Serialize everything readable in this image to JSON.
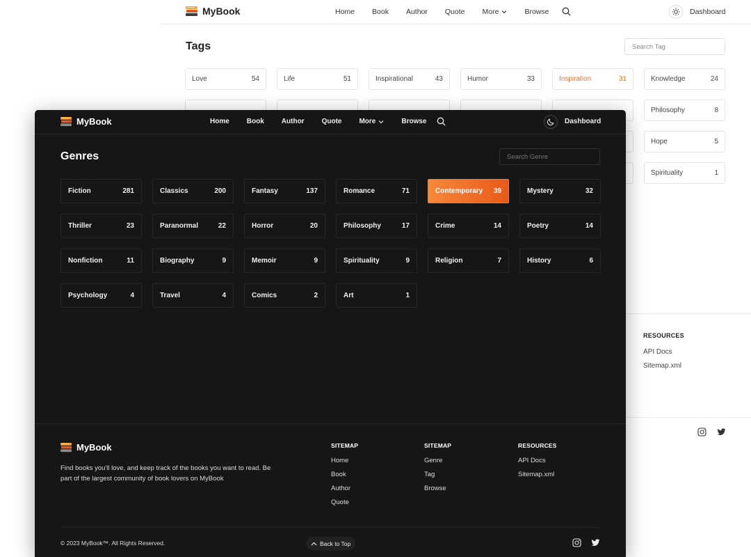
{
  "brand": {
    "name": "MyBook"
  },
  "light": {
    "nav": [
      "Home",
      "Book",
      "Author",
      "Quote",
      "More",
      "Browse"
    ],
    "dashboard": "Dashboard",
    "title": "Tags",
    "search_placeholder": "Search Tag",
    "tags": [
      {
        "label": "Love",
        "count": "54"
      },
      {
        "label": "Life",
        "count": "51"
      },
      {
        "label": "Inspirational",
        "count": "43"
      },
      {
        "label": "Humor",
        "count": "33"
      },
      {
        "label": "Inspiration",
        "count": "31"
      },
      {
        "label": "Knowledge",
        "count": "24"
      },
      {
        "label": "Philosophy",
        "count": "8"
      },
      {
        "label": "Hope",
        "count": "5"
      },
      {
        "label": "Spirituality",
        "count": "1"
      }
    ],
    "footer": {
      "resources_head": "RESOURCES",
      "resources": [
        "API Docs",
        "Sitemap.xml"
      ]
    }
  },
  "dark": {
    "nav": [
      "Home",
      "Book",
      "Author",
      "Quote",
      "More",
      "Browse"
    ],
    "dashboard": "Dashboard",
    "title": "Genres",
    "search_placeholder": "Search Genre",
    "genres": [
      {
        "label": "Fiction",
        "count": "281"
      },
      {
        "label": "Classics",
        "count": "200"
      },
      {
        "label": "Fantasy",
        "count": "137"
      },
      {
        "label": "Romance",
        "count": "71"
      },
      {
        "label": "Contemporary",
        "count": "39"
      },
      {
        "label": "Mystery",
        "count": "32"
      },
      {
        "label": "Thriller",
        "count": "23"
      },
      {
        "label": "Paranormal",
        "count": "22"
      },
      {
        "label": "Horror",
        "count": "20"
      },
      {
        "label": "Philosophy",
        "count": "17"
      },
      {
        "label": "Crime",
        "count": "14"
      },
      {
        "label": "Poetry",
        "count": "14"
      },
      {
        "label": "Nonfiction",
        "count": "11"
      },
      {
        "label": "Biography",
        "count": "9"
      },
      {
        "label": "Memoir",
        "count": "9"
      },
      {
        "label": "Spirituality",
        "count": "9"
      },
      {
        "label": "Religion",
        "count": "7"
      },
      {
        "label": "History",
        "count": "6"
      },
      {
        "label": "Psychology",
        "count": "4"
      },
      {
        "label": "Travel",
        "count": "4"
      },
      {
        "label": "Comics",
        "count": "2"
      },
      {
        "label": "Art",
        "count": "1"
      }
    ],
    "footer": {
      "description": "Find books you'll love, and keep track of the books you want to read. Be part of the largest community of book lovers on MyBook",
      "col1_head": "SITEMAP",
      "col1": [
        "Home",
        "Book",
        "Author",
        "Quote"
      ],
      "col2_head": "SITEMAP",
      "col2": [
        "Genre",
        "Tag",
        "Browse"
      ],
      "col3_head": "RESOURCES",
      "col3": [
        "API Docs",
        "Sitemap.xml"
      ],
      "copyright": "© 2023 MyBook™. All Rights Reserved.",
      "back_to_top": "Back to Top"
    }
  },
  "colors": {
    "accent": "#f26a1b",
    "dark_bg": "#161616"
  },
  "icons": [
    "book-stack-icon",
    "search-icon",
    "sun-icon",
    "moon-icon",
    "chevron-down-icon",
    "chevron-up-icon",
    "instagram-icon",
    "twitter-icon"
  ]
}
